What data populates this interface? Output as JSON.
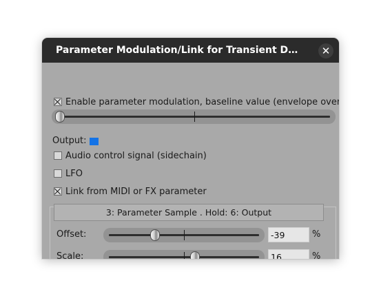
{
  "dialog": {
    "title": "Parameter Modulation/Link for Transient Decay / S...",
    "close_glyph": "✕"
  },
  "baseline": {
    "label": "Enable parameter modulation, baseline value (envelope overrides):",
    "checked": true,
    "slider_fraction": 0.0
  },
  "output": {
    "label": "Output:",
    "color": "#1473e6"
  },
  "audio_control": {
    "label": "Audio control signal (sidechain)",
    "checked": false
  },
  "lfo": {
    "label": "LFO",
    "checked": false
  },
  "link": {
    "label": "Link from MIDI or FX parameter",
    "checked": true,
    "parameter_button": "3: Parameter Sample . Hold: 6: Output",
    "offset": {
      "label": "Offset:",
      "value": "-39",
      "unit": "%"
    },
    "scale": {
      "label": "Scale:",
      "value": "16",
      "unit": "%"
    }
  }
}
